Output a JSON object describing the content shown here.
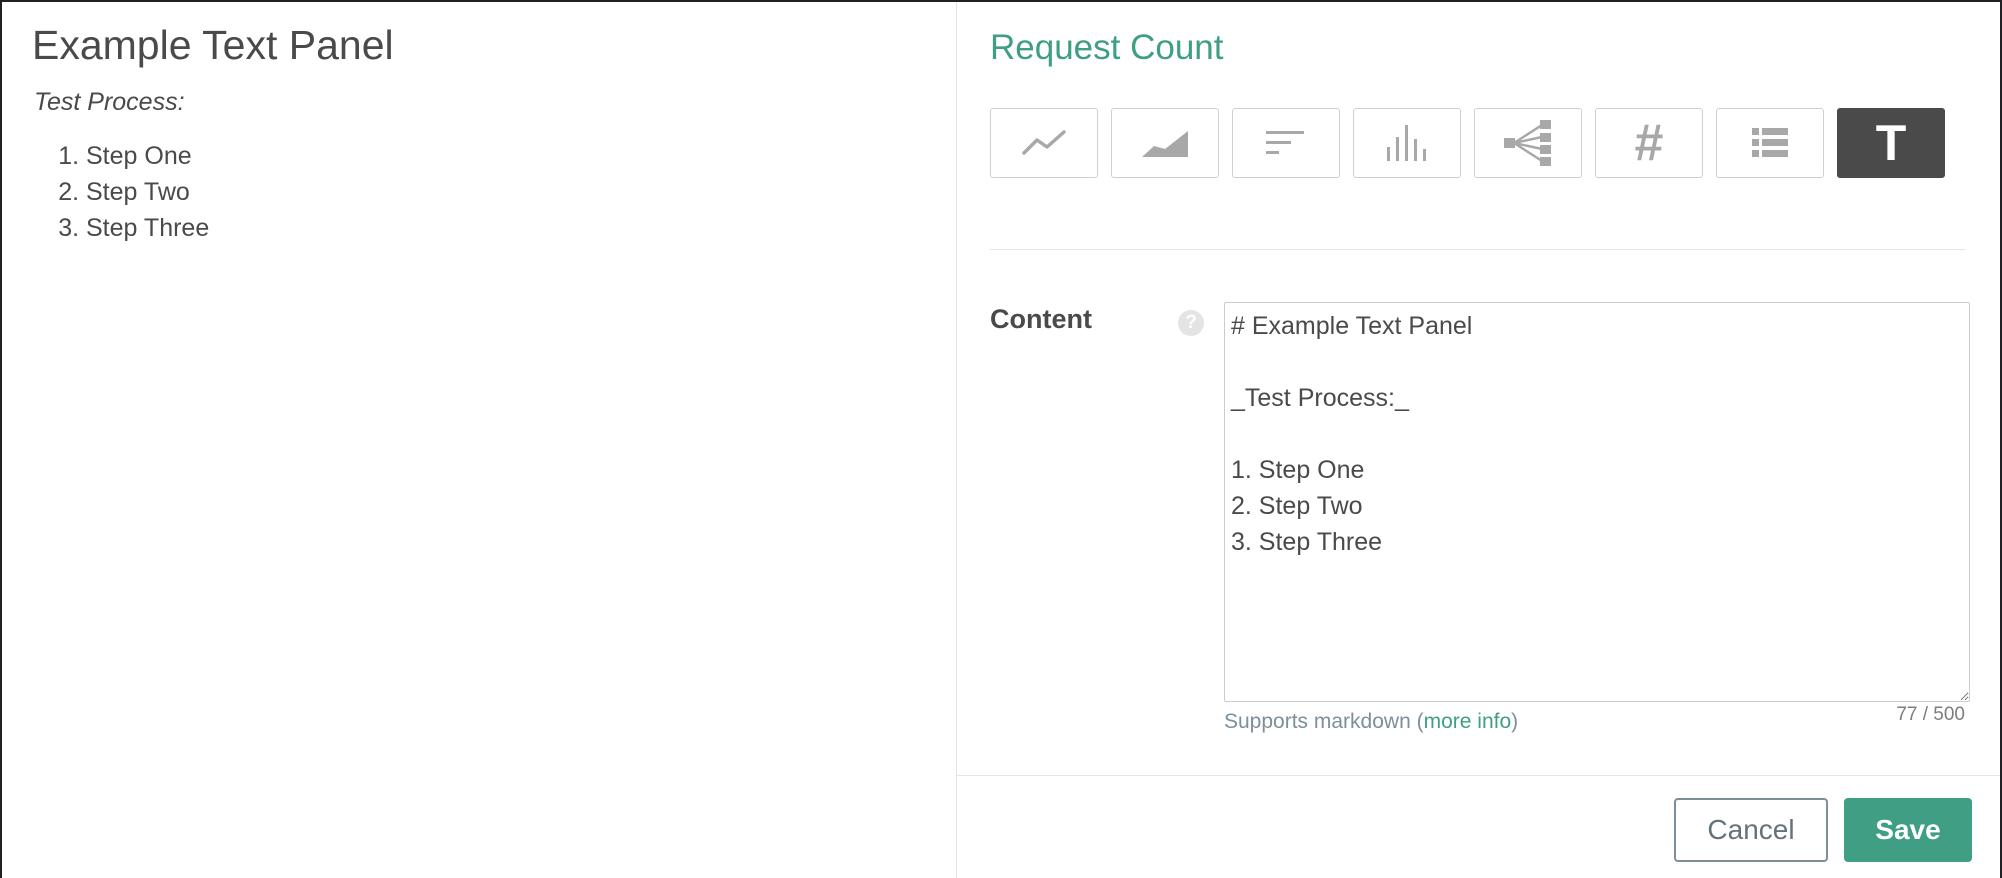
{
  "preview": {
    "title": "Example Text Panel",
    "subtitle": "Test Process:",
    "steps": [
      "Step One",
      "Step Two",
      "Step Three"
    ]
  },
  "editor": {
    "title": "Request Count",
    "visualization_types": [
      {
        "icon": "line-chart-icon"
      },
      {
        "icon": "area-chart-icon"
      },
      {
        "icon": "top-list-icon"
      },
      {
        "icon": "histogram-icon"
      },
      {
        "icon": "topology-icon"
      },
      {
        "icon": "number-icon",
        "label": "#"
      },
      {
        "icon": "table-icon"
      },
      {
        "icon": "text-icon",
        "label": "T",
        "selected": true
      }
    ],
    "content": {
      "label": "Content",
      "help_icon": "?",
      "value": "# Example Text Panel\n\n_Test Process:_\n\n1. Step One\n2. Step Two\n3. Step Three\n",
      "char_count": "77 / 500",
      "hint_prefix": "Supports markdown (",
      "hint_link": "more info",
      "hint_suffix": ")"
    },
    "buttons": {
      "cancel": "Cancel",
      "save": "Save"
    }
  },
  "colors": {
    "accent": "#3f9e84",
    "text": "#4a4a4a",
    "active_button": "#4a4a4a"
  }
}
